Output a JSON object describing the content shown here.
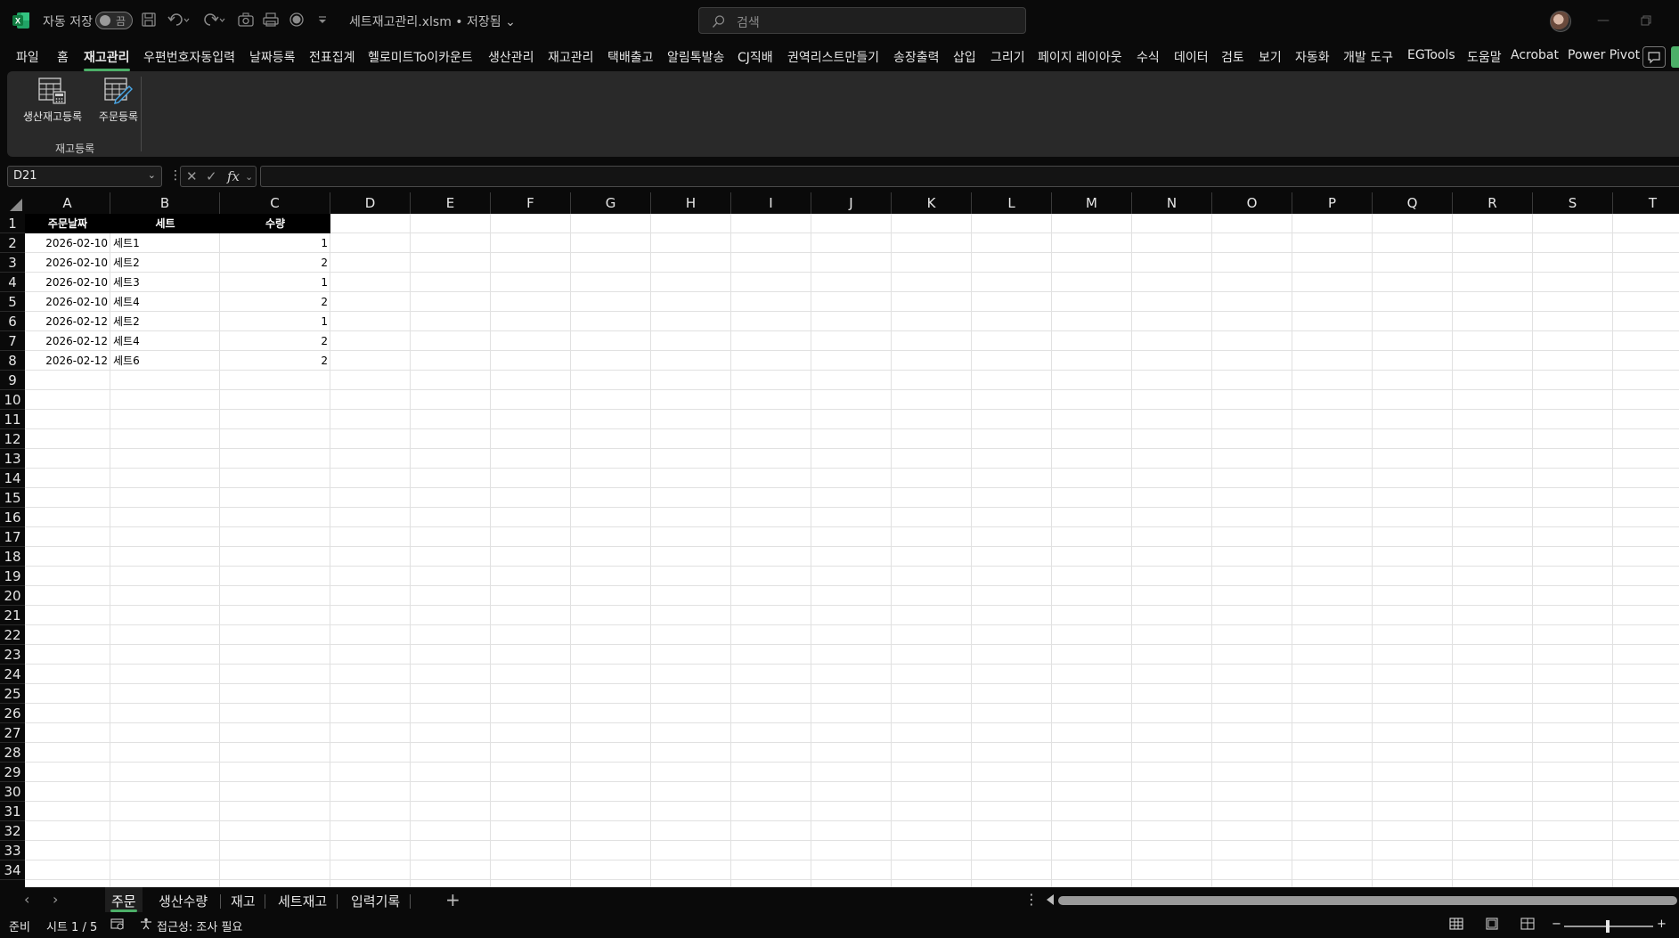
{
  "titlebar": {
    "autosave_label": "자동 저장",
    "autosave_state": "끔",
    "document_title": "세트재고관리.xlsm • 저장됨 ⌄",
    "search_placeholder": "검색",
    "accent_color": "#4caf68"
  },
  "menu": {
    "tabs": [
      "파일",
      "홈",
      "재고관리",
      "우편번호자동입력",
      "날짜등록",
      "전표집계",
      "헬로미트To이카운트",
      "생산관리",
      "재고관리",
      "택배출고",
      "알림톡발송",
      "CJ직배",
      "권역리스트만들기",
      "송장출력",
      "삽입",
      "그리기",
      "페이지 레이아웃",
      "수식",
      "데이터",
      "검토",
      "보기",
      "자동화",
      "개발 도구",
      "EGTools",
      "도움말",
      "Acrobat",
      "Power Pivot"
    ],
    "active_index": 2
  },
  "ribbon": {
    "buttons": [
      "생산재고등록",
      "주문등록"
    ],
    "group_label": "재고등록"
  },
  "formula_bar": {
    "name_box": "D21",
    "fx": "fx",
    "value": ""
  },
  "grid": {
    "columns": [
      "A",
      "B",
      "C",
      "D",
      "E",
      "F",
      "G",
      "H",
      "I",
      "J",
      "K",
      "L",
      "M",
      "N",
      "O",
      "P",
      "Q",
      "R",
      "S",
      "T"
    ],
    "rows": [
      "1",
      "2",
      "3",
      "4",
      "5",
      "6",
      "7",
      "8",
      "9",
      "10",
      "11",
      "12",
      "13",
      "14",
      "15",
      "16",
      "17",
      "18",
      "19",
      "20",
      "21",
      "22",
      "23",
      "24",
      "25",
      "26",
      "27",
      "28",
      "29",
      "30",
      "31",
      "32",
      "33",
      "34"
    ],
    "header": [
      "주문날짜",
      "세트",
      "수량"
    ],
    "data": [
      [
        "2026-02-10",
        "세트1",
        "1"
      ],
      [
        "2026-02-10",
        "세트2",
        "2"
      ],
      [
        "2026-02-10",
        "세트3",
        "1"
      ],
      [
        "2026-02-10",
        "세트4",
        "2"
      ],
      [
        "2026-02-12",
        "세트2",
        "1"
      ],
      [
        "2026-02-12",
        "세트4",
        "2"
      ],
      [
        "2026-02-12",
        "세트6",
        "2"
      ]
    ]
  },
  "sheets": {
    "tabs": [
      "주문",
      "생산수량",
      "재고",
      "세트재고",
      "입력기록"
    ],
    "active_index": 0
  },
  "status": {
    "ready": "준비",
    "sheet_position": "시트 1 / 5",
    "accessibility": "접근성: 조사 필요"
  }
}
